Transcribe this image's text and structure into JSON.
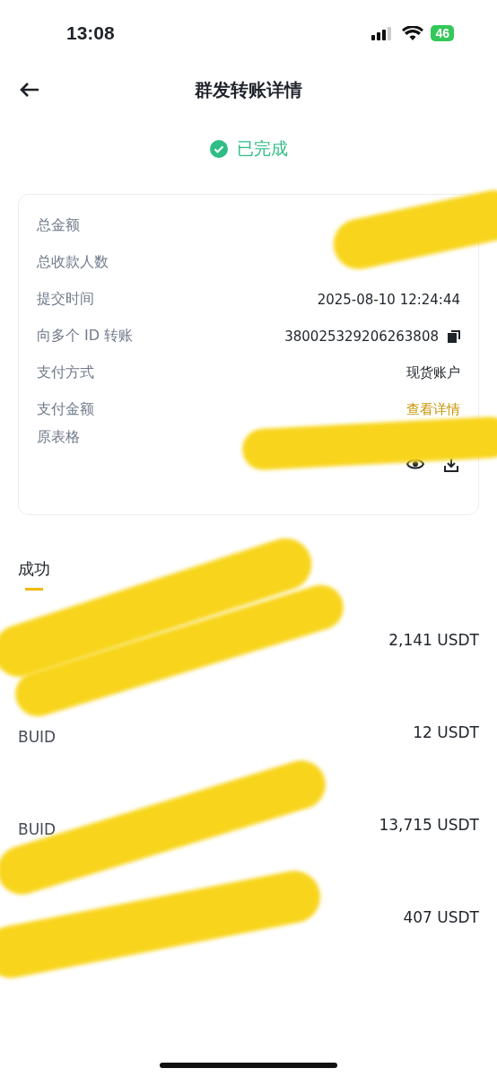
{
  "status_bar": {
    "time": "13:08",
    "battery": "46"
  },
  "header": {
    "title": "群发转账详情"
  },
  "status": {
    "label": "已完成"
  },
  "details": [
    {
      "label": "总金额"
    },
    {
      "label": "总收款人数"
    },
    {
      "label": "提交时间",
      "value": "2025-08-10 12:24:44"
    },
    {
      "label": "向多个 ID 转账",
      "value": "380025329206263808",
      "kind": "copy"
    },
    {
      "label": "支付方式",
      "value": "现货账户"
    },
    {
      "label": "支付金额",
      "value": "查看详情",
      "kind": "link"
    },
    {
      "label": "原表格",
      "kind": "file"
    }
  ],
  "tabs": [
    {
      "label": "成功",
      "selected": true
    }
  ],
  "recipients": [
    {
      "amount": "2,141 USDT"
    },
    {
      "id": "BUID",
      "amount": "12 USDT"
    },
    {
      "id": "BUID",
      "amount": "13,715 USDT"
    },
    {
      "amount": "407 USDT"
    }
  ]
}
